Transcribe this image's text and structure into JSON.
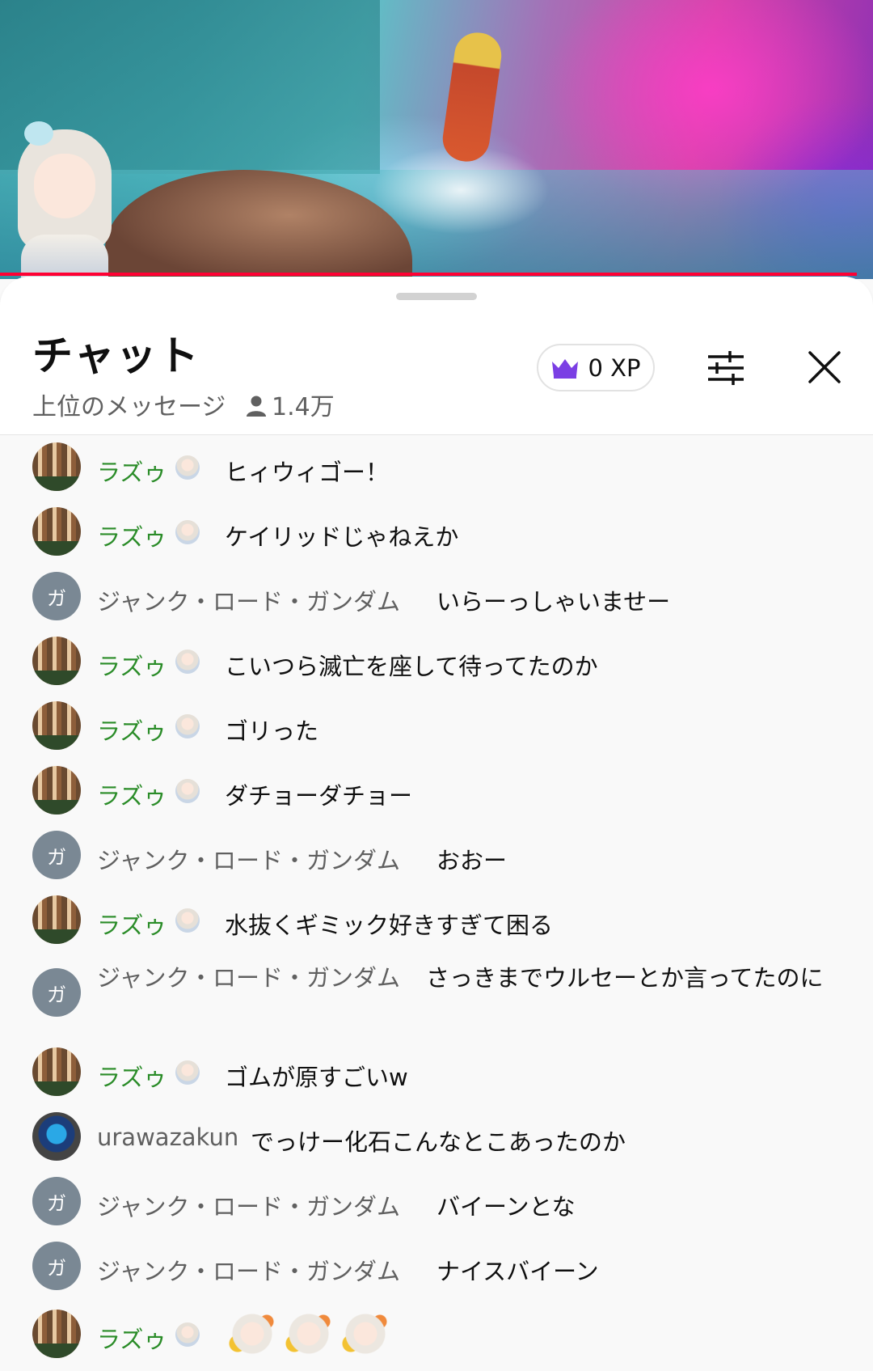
{
  "chat": {
    "title": "チャット",
    "mode_label": "上位のメッセージ",
    "viewer_count": "1.4万",
    "xp_label": "0 XP"
  },
  "icons": {
    "viewer": "person-icon",
    "xp": "crown-icon",
    "filter": "sliders-icon",
    "close": "close-icon"
  },
  "colors": {
    "progress": "#ff0033",
    "author_member": "#2a8c28",
    "author_default": "#606060",
    "xp_crown": "#7b3fe4"
  },
  "messages": [
    {
      "author": "ラズゥ",
      "text": "ヒィウィゴー！"
    },
    {
      "author": "ラズゥ",
      "text": "ケイリッドじゃねえか"
    },
    {
      "author": "ジャンク・ロード・ガンダム",
      "avatar_letter": "ガ",
      "text": "いらーっしゃいませー"
    },
    {
      "author": "ラズゥ",
      "text": "こいつら滅亡を座して待ってたのか"
    },
    {
      "author": "ラズゥ",
      "text": "ゴリった"
    },
    {
      "author": "ラズゥ",
      "text": "ダチョーダチョー"
    },
    {
      "author": "ジャンク・ロード・ガンダム",
      "avatar_letter": "ガ",
      "text": "おおー"
    },
    {
      "author": "ラズゥ",
      "text": "水抜くギミック好きすぎて困る"
    },
    {
      "author": "ジャンク・ロード・ガンダム",
      "avatar_letter": "ガ",
      "text": "さっきまでウルセーとか言ってたのに"
    },
    {
      "author": "ラズゥ",
      "text": "ゴムが原すごいw"
    },
    {
      "author": "urawazakun",
      "text": "でっけー化石こんなとこあったのか"
    },
    {
      "author": "ジャンク・ロード・ガンダム",
      "avatar_letter": "ガ",
      "text": "バイーンとな"
    },
    {
      "author": "ジャンク・ロード・ガンダム",
      "avatar_letter": "ガ",
      "text": "ナイスバイーン"
    },
    {
      "author": "ラズゥ",
      "text": ""
    }
  ]
}
